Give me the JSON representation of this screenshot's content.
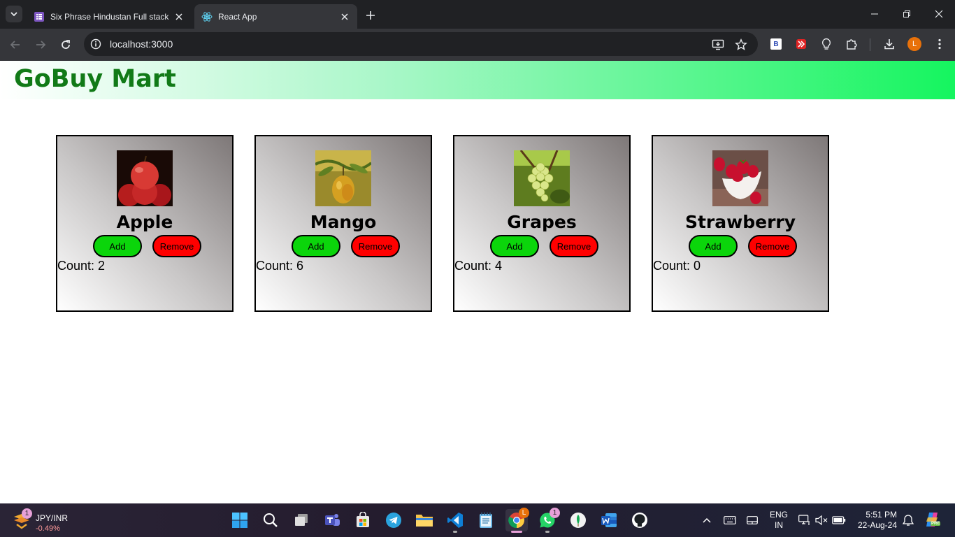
{
  "browser": {
    "tabs": [
      {
        "title": "Six Phrase Hindustan Full stack",
        "favicon": "forms-icon"
      },
      {
        "title": "React App",
        "favicon": "react-icon"
      }
    ],
    "address": "localhost:3000",
    "profile_initial": "L",
    "extension_b_label": "B"
  },
  "page": {
    "brand": "GoBuy Mart",
    "products": [
      {
        "name": "Apple",
        "add_label": "Add",
        "remove_label": "Remove",
        "count_label": "Count: 2",
        "count": 2,
        "image": "apple-image"
      },
      {
        "name": "Mango",
        "add_label": "Add",
        "remove_label": "Remove",
        "count_label": "Count: 6",
        "count": 6,
        "image": "mango-image"
      },
      {
        "name": "Grapes",
        "add_label": "Add",
        "remove_label": "Remove",
        "count_label": "Count: 4",
        "count": 4,
        "image": "grapes-image"
      },
      {
        "name": "Strawberry",
        "add_label": "Add",
        "remove_label": "Remove",
        "count_label": "Count: 0",
        "count": 0,
        "image": "strawberry-image"
      }
    ],
    "colors": {
      "brand_text": "#117a17",
      "add_button": "#0bd50b",
      "remove_button": "#ff0000"
    }
  },
  "taskbar": {
    "widget": {
      "symbol": "JPY/INR",
      "change": "-0.49%",
      "badge": "1"
    },
    "whatsapp_badge": "1",
    "chrome_badge": "L",
    "language": "ENG",
    "region": "IN",
    "time": "5:51 PM",
    "date": "22-Aug-24",
    "copilot_badge": "PRE"
  }
}
